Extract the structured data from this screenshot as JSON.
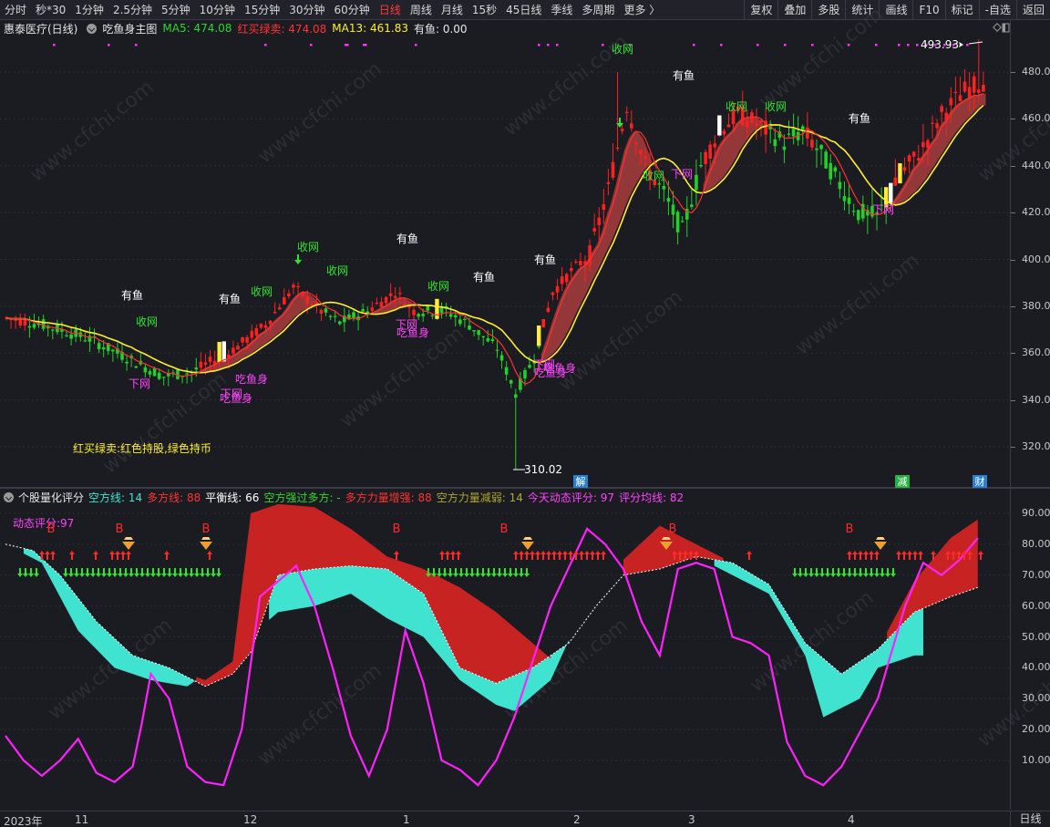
{
  "toolbar": {
    "left_items": [
      "分时",
      "秒*30",
      "1分钟",
      "2.5分钟",
      "5分钟",
      "10分钟",
      "15分钟",
      "30分钟",
      "60分钟",
      "日线",
      "周线",
      "月线",
      "15秒",
      "45日线",
      "季线",
      "多周期",
      "更多 〉"
    ],
    "active_item": "日线",
    "right_items": [
      "复权",
      "叠加",
      "多股",
      "统计",
      "画线",
      "F10",
      "标记",
      "-自选",
      "返回"
    ]
  },
  "main_panel": {
    "stock_title": "惠泰医疗(日线)",
    "indicator_name": "吃鱼身主图",
    "ma5": "MA5: 474.08",
    "red_buy": "红买绿卖: 474.08",
    "ma13": "MA13: 461.83",
    "you_yu": "有鱼: 0.00",
    "legend_note": "红买绿卖:红色持股,绿色持币",
    "high_label": "493.93",
    "low_label": "310.02",
    "y_ticks": [
      "480.00",
      "460.00",
      "440.00",
      "420.00",
      "400.00",
      "380.00",
      "360.00",
      "340.00",
      "320.00"
    ],
    "y_values": [
      480,
      460,
      440,
      420,
      400,
      380,
      360,
      340,
      320
    ],
    "event_markers": [
      "解",
      "减",
      "财"
    ],
    "colors": {
      "up": "#ff2020",
      "down": "#22d02a",
      "ma5": "#ff3030",
      "ma13": "#ffee33",
      "band": "#a83c3c",
      "magenta": "#ff33ff"
    }
  },
  "annotations": {
    "you_yu": "有鱼",
    "shou_wang": "收网",
    "xia_wang": "下网",
    "chi_yu_shen": "吃鱼身"
  },
  "sub_panel": {
    "title": "个股量化评分",
    "kong_fang": "空方线: 14",
    "duo_fang": "多方线: 88",
    "ping_heng": "平衡线: 66",
    "kong_qiang_guo_duo": "空方强过多方: -",
    "duo_zeng_qiang": "多方力量增强: 88",
    "kong_jian_ruo": "空方力量减弱: 14",
    "today_score": "今天动态评分: 97",
    "avg_score": "评分均线: 82",
    "dynamic_score_label": "动态评分:97",
    "buy_marker": "B",
    "y_ticks": [
      "90.00",
      "80.00",
      "70.00",
      "60.00",
      "50.00",
      "40.00",
      "30.00",
      "20.00",
      "10.00"
    ],
    "y_values": [
      90,
      80,
      70,
      60,
      50,
      40,
      30,
      20,
      10
    ],
    "colors": {
      "kong": "#3fe3d0",
      "duo": "#c82323",
      "score": "#ff22ff",
      "balance": "#ffffff"
    }
  },
  "x_axis": {
    "labels": [
      "2023年",
      "11",
      "12",
      "1",
      "2",
      "3",
      "4"
    ],
    "period": "日线"
  },
  "watermark": "www.cfchi.com"
}
